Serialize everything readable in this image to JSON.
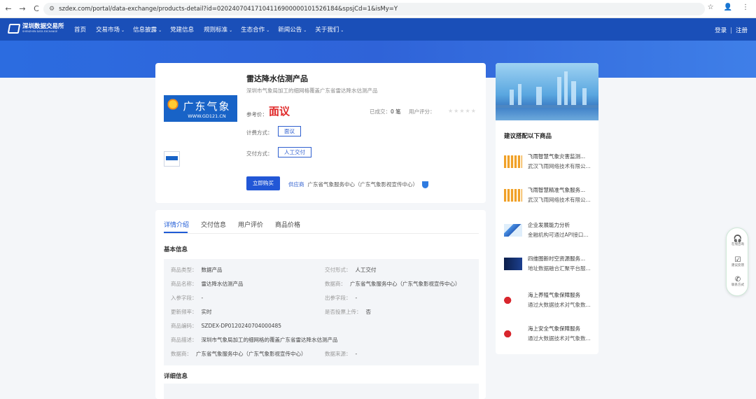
{
  "browser": {
    "url": "szdex.com/portal/data-exchange/products-detail?id=02024070417104116900000101526184&spsjCd=1&isMy=Y",
    "back": "←",
    "forward": "→",
    "reload": "C",
    "star": "☆",
    "profile": "👤",
    "menu": "⋮"
  },
  "site": {
    "logo_cn": "深圳数据交易所",
    "logo_en": "SHENZHEN DATA EXCHANGE",
    "menu": [
      {
        "label": "首页",
        "chev": ""
      },
      {
        "label": "交易市场",
        "chev": "⌄"
      },
      {
        "label": "信息披露",
        "chev": "⌄"
      },
      {
        "label": "党建信息",
        "chev": ""
      },
      {
        "label": "规则标准",
        "chev": "⌄"
      },
      {
        "label": "生态合作",
        "chev": "⌄"
      },
      {
        "label": "新闻公告",
        "chev": "⌄"
      },
      {
        "label": "关于我们",
        "chev": "⌄"
      }
    ],
    "login": "登录",
    "sep": "|",
    "register": "注册"
  },
  "product": {
    "image_cn": "广东气象",
    "image_url": "WWW.GD121.CN",
    "title": "雷达降水估测产品",
    "desc": "深圳市气象局加工的细网格覆盖广东省雷达降水估测产品",
    "price_label": "参考价：",
    "price": "面议",
    "sold_label": "已成交：",
    "sold": "0 笔",
    "rating_label": "用户评分：",
    "stars": "★★★★★",
    "billing_label": "计费方式：",
    "billing": "面议",
    "delivery_label": "交付方式：",
    "delivery": "人工交付",
    "buy": "立即购买",
    "provider_label": "供应商",
    "provider": "广东省气象服务中心（广东气象影视宣传中心）"
  },
  "detail": {
    "tabs": [
      "详情介绍",
      "交付信息",
      "用户评价",
      "商品价格"
    ],
    "basic_title": "基本信息",
    "rows": [
      {
        "k": "商品类型：",
        "v": "数据产品"
      },
      {
        "k": "交付形式：",
        "v": "人工交付"
      },
      {
        "k": "商品名称：",
        "v": "雷达降水估测产品"
      },
      {
        "k": "数据商：",
        "v": "广东省气象服务中心（广东气象影视宣传中心）"
      },
      {
        "k": "入参字段：",
        "v": "-"
      },
      {
        "k": "出参字段：",
        "v": "-"
      },
      {
        "k": "更新频率：",
        "v": "实时"
      },
      {
        "k": "是否投票上传：",
        "v": "否"
      },
      {
        "k": "商品编码：",
        "v": "SZDEX-DP0120240704000485"
      },
      {
        "k": "商品描述：",
        "v": "深圳市气象局加工的细网格的覆盖广东省雷达降水估测产品"
      },
      {
        "k": "数据商：",
        "v": "广东省气象服务中心（广东气象影视宣传中心）"
      },
      {
        "k": "数据来源：",
        "v": "-"
      }
    ],
    "detail_title": "详细信息"
  },
  "recommend": {
    "title": "建议搭配以下商品",
    "items": [
      {
        "l1": "飞雨智慧气象灾害监测...",
        "l2": "武汉飞雨网络技术有限公..."
      },
      {
        "l1": "飞雨智慧精准气象服务...",
        "l2": "武汉飞雨网络技术有限公..."
      },
      {
        "l1": "企业发展能力分析",
        "l2": "金融机构可通过API接口..."
      },
      {
        "l1": "四维图新时空资源服务...",
        "l2": "地址数据融合汇聚平台服..."
      },
      {
        "l1": "海上养殖气象保障服务",
        "l2": "通过大数据技术对气象数..."
      },
      {
        "l1": "海上安全气象保障服务",
        "l2": "通过大数据技术对气象数..."
      }
    ]
  },
  "float": [
    {
      "icon": "🎧",
      "label": "在线咨询"
    },
    {
      "icon": "☑",
      "label": "建议反馈"
    },
    {
      "icon": "✆",
      "label": "联系方式"
    }
  ]
}
